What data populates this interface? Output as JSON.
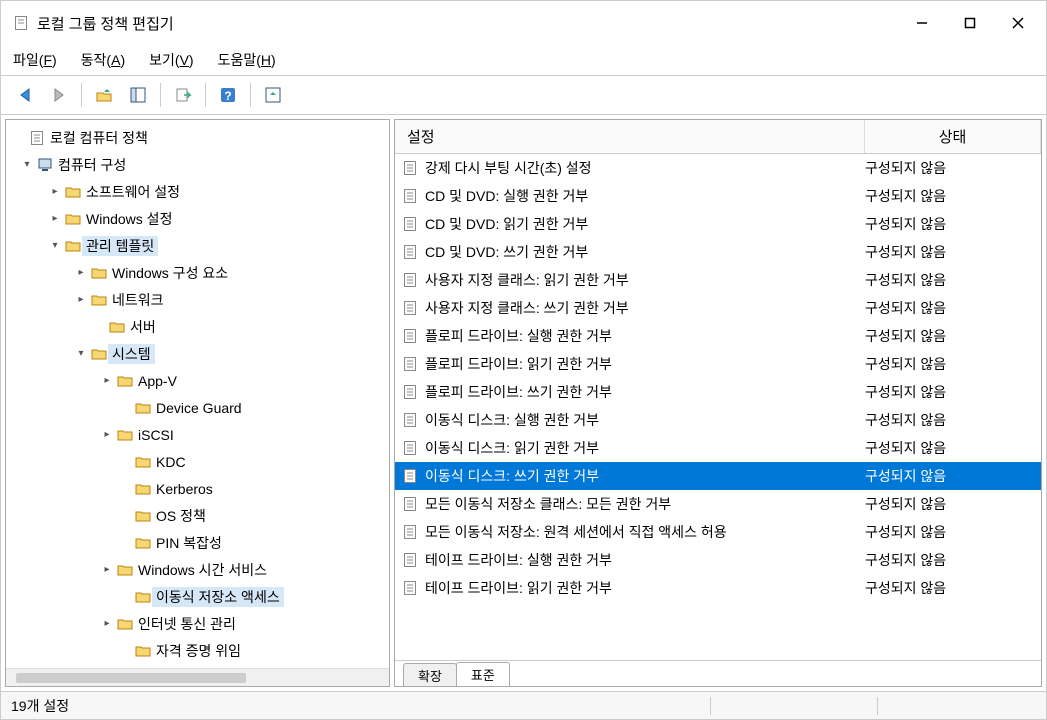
{
  "title": "로컬 그룹 정책 편집기",
  "menu": {
    "file": "파일(F)",
    "action": "동작(A)",
    "view": "보기(V)",
    "help": "도움말(H)"
  },
  "tree": {
    "root": "로컬 컴퓨터 정책",
    "computer_config": "컴퓨터 구성",
    "software": "소프트웨어 설정",
    "windows_settings": "Windows 설정",
    "admin_templates": "관리 템플릿",
    "win_components": "Windows 구성 요소",
    "network": "네트워크",
    "server": "서버",
    "system": "시스템",
    "appv": "App-V",
    "device_guard": "Device Guard",
    "iscsi": "iSCSI",
    "kdc": "KDC",
    "kerberos": "Kerberos",
    "os_policy": "OS 정책",
    "pin": "PIN 복잡성",
    "time_service": "Windows 시간 서비스",
    "removable": "이동식 저장소 액세스",
    "internet_comm": "인터넷 통신 관리",
    "cred_delegation": "자격 증명 위임"
  },
  "columns": {
    "setting": "설정",
    "state": "상태"
  },
  "list": [
    {
      "name": "강제 다시 부팅 시간(초) 설정",
      "state": "구성되지 않음",
      "sel": false
    },
    {
      "name": "CD 및 DVD: 실행 권한 거부",
      "state": "구성되지 않음",
      "sel": false
    },
    {
      "name": "CD 및 DVD: 읽기 권한 거부",
      "state": "구성되지 않음",
      "sel": false
    },
    {
      "name": "CD 및 DVD: 쓰기 권한 거부",
      "state": "구성되지 않음",
      "sel": false
    },
    {
      "name": "사용자 지정 클래스: 읽기 권한 거부",
      "state": "구성되지 않음",
      "sel": false
    },
    {
      "name": "사용자 지정 클래스: 쓰기 권한 거부",
      "state": "구성되지 않음",
      "sel": false
    },
    {
      "name": "플로피 드라이브: 실행 권한 거부",
      "state": "구성되지 않음",
      "sel": false
    },
    {
      "name": "플로피 드라이브: 읽기 권한 거부",
      "state": "구성되지 않음",
      "sel": false
    },
    {
      "name": "플로피 드라이브: 쓰기 권한 거부",
      "state": "구성되지 않음",
      "sel": false
    },
    {
      "name": "이동식 디스크: 실행 권한 거부",
      "state": "구성되지 않음",
      "sel": false
    },
    {
      "name": "이동식 디스크: 읽기 권한 거부",
      "state": "구성되지 않음",
      "sel": false
    },
    {
      "name": "이동식 디스크: 쓰기 권한 거부",
      "state": "구성되지 않음",
      "sel": true
    },
    {
      "name": "모든 이동식 저장소 클래스: 모든 권한 거부",
      "state": "구성되지 않음",
      "sel": false
    },
    {
      "name": "모든 이동식 저장소: 원격 세션에서 직접 액세스 허용",
      "state": "구성되지 않음",
      "sel": false
    },
    {
      "name": "테이프 드라이브: 실행 권한 거부",
      "state": "구성되지 않음",
      "sel": false
    },
    {
      "name": "테이프 드라이브: 읽기 권한 거부",
      "state": "구성되지 않음",
      "sel": false
    }
  ],
  "tabs": {
    "ext": "확장",
    "std": "표준"
  },
  "status": "19개 설정"
}
